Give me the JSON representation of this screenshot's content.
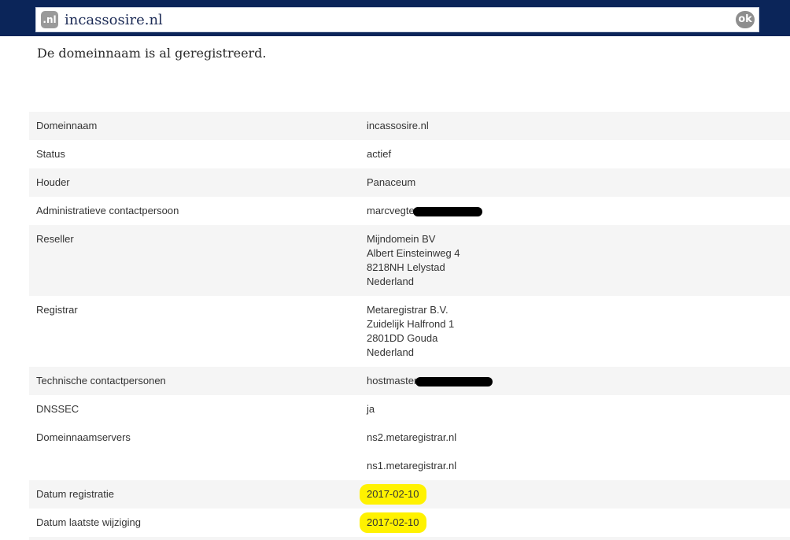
{
  "header": {
    "badge": ".nl",
    "domain_value": "incassosire.nl",
    "ok_label": "ok"
  },
  "message": "De domeinnaam is al geregistreerd.",
  "rows": [
    {
      "label": "Domeinnaam",
      "lines": [
        "incassosire.nl"
      ]
    },
    {
      "label": "Status",
      "lines": [
        "actief"
      ]
    },
    {
      "label": "Houder",
      "lines": [
        "Panaceum"
      ]
    },
    {
      "label": "Administratieve contactpersoon",
      "lines": [
        "marcvegte"
      ]
    },
    {
      "label": "Reseller",
      "lines": [
        "Mijndomein BV",
        "Albert Einsteinweg 4",
        "8218NH Lelystad",
        "Nederland"
      ]
    },
    {
      "label": "Registrar",
      "lines": [
        "Metaregistrar B.V.",
        "Zuidelijk Halfrond 1",
        "2801DD Gouda",
        "Nederland"
      ]
    },
    {
      "label": "Technische contactpersonen",
      "lines": [
        "hostmaster"
      ]
    },
    {
      "label": "DNSSEC",
      "lines": [
        "ja"
      ]
    },
    {
      "label": "Domeinnaamservers",
      "lines": [
        "ns2.metaregistrar.nl"
      ]
    },
    {
      "label": "",
      "lines": [
        "ns1.metaregistrar.nl"
      ]
    },
    {
      "label": "Datum registratie",
      "lines": [
        "2017-02-10"
      ]
    },
    {
      "label": "Datum laatste wijziging",
      "lines": [
        "2017-02-10"
      ]
    }
  ],
  "colors": {
    "header_bg": "#0b2559",
    "highlight": "#fff200",
    "row_shade": "#f5f5f5"
  }
}
